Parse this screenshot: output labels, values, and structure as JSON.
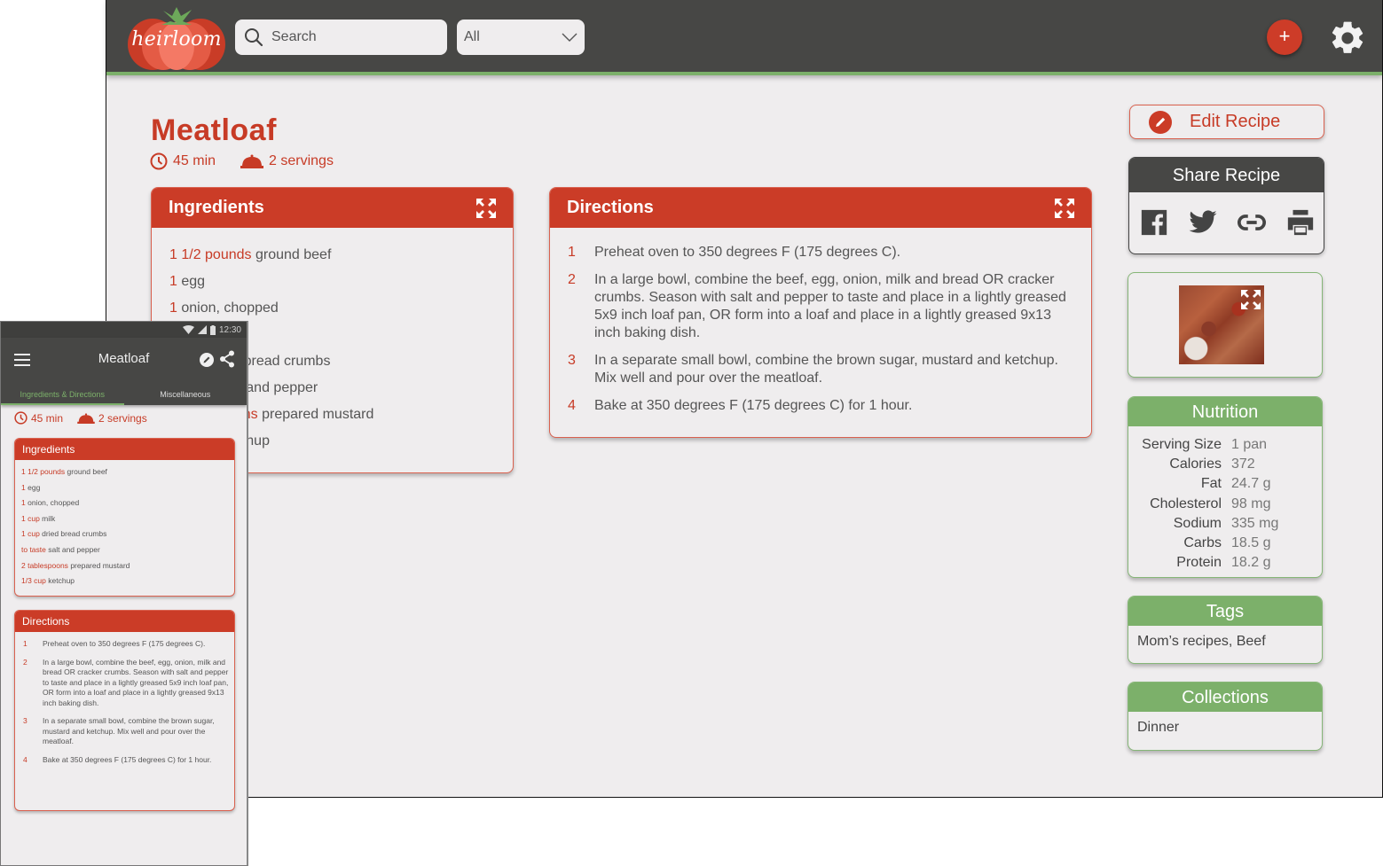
{
  "app": {
    "logo_text": "heirloom",
    "search_placeholder": "Search",
    "filter_selected": "All",
    "add_label": "+",
    "colors": {
      "primary": "#cb3c27",
      "accent": "#7cb06a",
      "dark": "#474745",
      "background": "#efedee"
    }
  },
  "recipe": {
    "title": "Meatloaf",
    "time": "45 min",
    "servings": "2 servings"
  },
  "ingredients": {
    "title": "Ingredients",
    "items": [
      {
        "qty": "1 1/2 pounds",
        "name": "ground beef"
      },
      {
        "qty": "1",
        "name": "egg"
      },
      {
        "qty": "1",
        "name": "onion, chopped"
      },
      {
        "qty": "1 cup",
        "name": "milk"
      },
      {
        "qty": "1 cup",
        "name": "dried bread crumbs"
      },
      {
        "qty": "to taste",
        "name": "salt and pepper"
      },
      {
        "qty": "2 tablespoons",
        "name": "prepared mustard"
      },
      {
        "qty": "1/3 cup",
        "name": "ketchup"
      }
    ]
  },
  "directions": {
    "title": "Directions",
    "steps": [
      {
        "num": "1",
        "text": "Preheat oven to 350 degrees F (175 degrees C)."
      },
      {
        "num": "2",
        "text": "In a large bowl, combine the beef, egg, onion, milk and bread OR cracker crumbs. Season with salt and pepper to taste and place in a lightly greased 5x9 inch loaf pan, OR form into a loaf and place in a lightly greased 9x13 inch baking dish."
      },
      {
        "num": "3",
        "text": "In a separate small bowl, combine the brown sugar, mustard and ketchup. Mix well and pour over the meatloaf."
      },
      {
        "num": "4",
        "text": "Bake at 350 degrees F (175 degrees C) for 1 hour."
      }
    ]
  },
  "sidebar": {
    "edit_label": "Edit Recipe",
    "share_title": "Share Recipe",
    "share_icons": [
      "facebook-icon",
      "twitter-icon",
      "link-icon",
      "print-icon"
    ],
    "nutrition": {
      "title": "Nutrition",
      "rows": [
        {
          "label": "Serving Size",
          "value": "1 pan"
        },
        {
          "label": "Calories",
          "value": "372"
        },
        {
          "label": "Fat",
          "value": "24.7 g"
        },
        {
          "label": "Cholesterol",
          "value": "98 mg"
        },
        {
          "label": "Sodium",
          "value": "335 mg"
        },
        {
          "label": "Carbs",
          "value": "18.5 g"
        },
        {
          "label": "Protein",
          "value": "18.2 g"
        }
      ]
    },
    "tags": {
      "title": "Tags",
      "value": "Mom’s recipes, Beef"
    },
    "collections": {
      "title": "Collections",
      "value": "Dinner"
    }
  },
  "mobile": {
    "status_time": "12:30",
    "title": "Meatloaf",
    "tabs": [
      {
        "label": "Ingredients & Directions",
        "active": true
      },
      {
        "label": "Miscellaneous",
        "active": false
      }
    ]
  }
}
